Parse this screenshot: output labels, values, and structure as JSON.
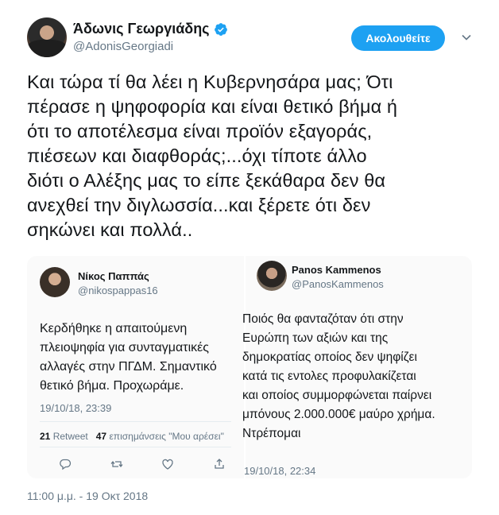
{
  "header": {
    "name": "Άδωνις Γεωργιάδης",
    "handle": "@AdonisGeorgiadi",
    "follow_label": "Ακολουθείτε",
    "verified_icon": "verified-badge-icon",
    "menu_icon": "chevron-down-icon"
  },
  "tweet": {
    "lines": [
      "Και τώρα τί θα λέει η Κυβερνησάρα μας; Ότι",
      "πέρασε η ψηφοφορία και είναι θετικό βήμα ή",
      "ότι το αποτέλεσμα είναι προϊόν εξαγοράς,",
      "πιέσεων και διαφθοράς;...όχι τίποτε άλλο",
      "διότι ο Αλέξης μας το είπε ξεκάθαρα δεν θα",
      "ανεχθεί την διγλωσσία...και ξέρετε ότι δεν",
      "σηκώνει και πολλά.."
    ],
    "timestamp": "11:00 μ.μ. - 19 Οκτ 2018"
  },
  "media": {
    "left": {
      "name": "Νίκος Παππάς",
      "handle": "@nikospappas16",
      "lines": [
        "Κερδήθηκε η απαιτούμενη",
        "πλειοψηφία για συνταγματικές",
        "αλλαγές στην ΠΓΔΜ. Σημαντικό",
        "θετικό βήμα. Προχωράμε."
      ],
      "date": "19/10/18, 23:39",
      "retweets": "21",
      "retweets_label": "Retweet",
      "likes": "47",
      "likes_label": "επισημάνσεις \"Μου αρέσει\""
    },
    "right": {
      "name": "Panos Kammenos",
      "handle": "@PanosKammenos",
      "lines": [
        "Ποιός θα φανταζόταν ότι στην",
        "Ευρώπη των αξιών και της",
        "δημοκρατίας οποίος δεν ψηφίζει",
        "κατά τις εντολες προφυλακίζεται",
        "και οποίος συμμορφώνεται παίρνει",
        "μπόνους 2.000.000€ μαύρο χρήμα.",
        "Ντρέπομαι"
      ],
      "date": "19/10/18, 22:34"
    }
  },
  "colors": {
    "accent": "#1da1f2",
    "secondary_text": "#657786",
    "primary_text": "#14171a"
  }
}
